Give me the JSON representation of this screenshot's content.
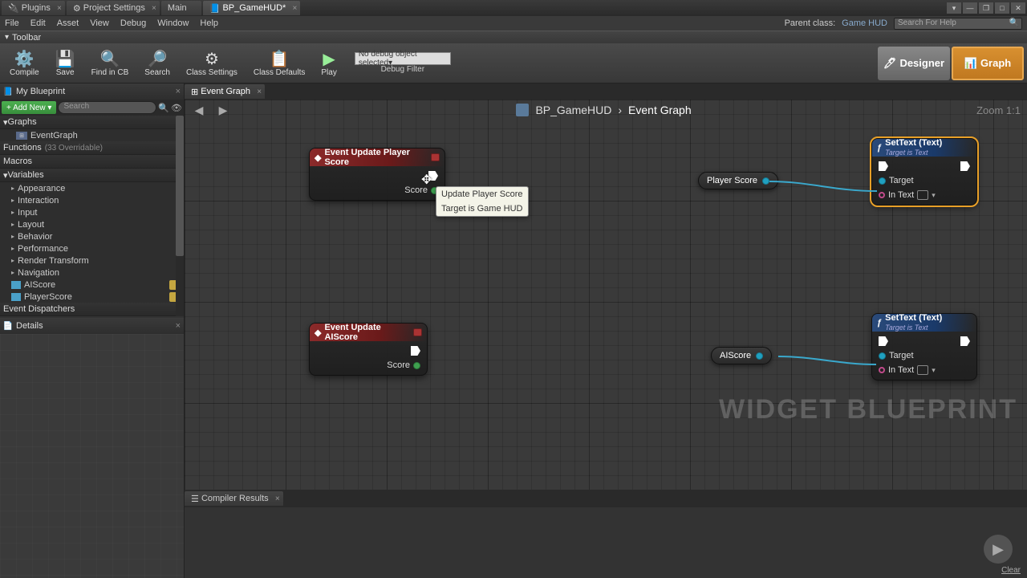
{
  "tabs_top": [
    {
      "label": "Plugins",
      "icon": "🔌"
    },
    {
      "label": "Project Settings",
      "icon": "⚙"
    },
    {
      "label": "Main",
      "icon": ""
    },
    {
      "label": "BP_GameHUD*",
      "icon": "📘",
      "active": true
    }
  ],
  "menus": [
    "File",
    "Edit",
    "Asset",
    "View",
    "Debug",
    "Window",
    "Help"
  ],
  "parent_class_label": "Parent class:",
  "parent_class_value": "Game HUD",
  "search_placeholder": "Search For Help",
  "toolbar_label": "Toolbar",
  "toolbar_buttons": [
    {
      "label": "Compile",
      "icon": "⚙️",
      "name": "compile-button"
    },
    {
      "label": "Save",
      "icon": "💾",
      "name": "save-button"
    },
    {
      "label": "Find in CB",
      "icon": "🔍",
      "name": "find-in-cb-button"
    },
    {
      "label": "Search",
      "icon": "🔎",
      "name": "search-button"
    },
    {
      "label": "Class Settings",
      "icon": "⚙",
      "name": "class-settings-button"
    },
    {
      "label": "Class Defaults",
      "icon": "📋",
      "name": "class-defaults-button"
    },
    {
      "label": "Play",
      "icon": "▶",
      "name": "play-button"
    }
  ],
  "debug_selector": "No debug object selected▾",
  "debug_filter": "Debug Filter",
  "mode_designer": "Designer",
  "mode_graph": "Graph",
  "left_panel": {
    "tab": "My Blueprint",
    "add_new": "+ Add New ▾",
    "search_placeholder": "Search",
    "sections": {
      "graphs": {
        "label": "Graphs",
        "items": [
          {
            "label": "EventGraph"
          }
        ]
      },
      "functions": {
        "label": "Functions",
        "sub": "(33 Overridable)"
      },
      "macros": {
        "label": "Macros"
      },
      "variables": {
        "label": "Variables",
        "items": [
          {
            "label": "Appearance"
          },
          {
            "label": "Interaction"
          },
          {
            "label": "Input"
          },
          {
            "label": "Layout"
          },
          {
            "label": "Behavior"
          },
          {
            "label": "Performance"
          },
          {
            "label": "Render Transform"
          },
          {
            "label": "Navigation"
          },
          {
            "label": "AIScore",
            "var": true
          },
          {
            "label": "PlayerScore",
            "var": true
          }
        ]
      },
      "event_dispatchers": {
        "label": "Event Dispatchers"
      }
    },
    "details_tab": "Details"
  },
  "graph": {
    "tab": "Event Graph",
    "crumb_root": "BP_GameHUD",
    "crumb_leaf": "Event Graph",
    "zoom": "Zoom 1:1",
    "nodes": {
      "event1": {
        "title": "Event Update Player Score",
        "pin": "Score"
      },
      "event2": {
        "title": "Event Update AIScore",
        "pin": "Score"
      },
      "var1": "Player Score",
      "var2": "AIScore",
      "set1": {
        "title": "SetText (Text)",
        "sub": "Target is Text",
        "pins": {
          "target": "Target",
          "intext": "In Text"
        }
      },
      "set2": {
        "title": "SetText (Text)",
        "sub": "Target is Text",
        "pins": {
          "target": "Target",
          "intext": "In Text"
        }
      }
    },
    "tooltip": {
      "line1": "Update Player Score",
      "line2": "Target is Game HUD"
    },
    "watermark": "WIDGET BLUEPRINT"
  },
  "compiler": {
    "tab": "Compiler Results",
    "clear": "Clear"
  }
}
